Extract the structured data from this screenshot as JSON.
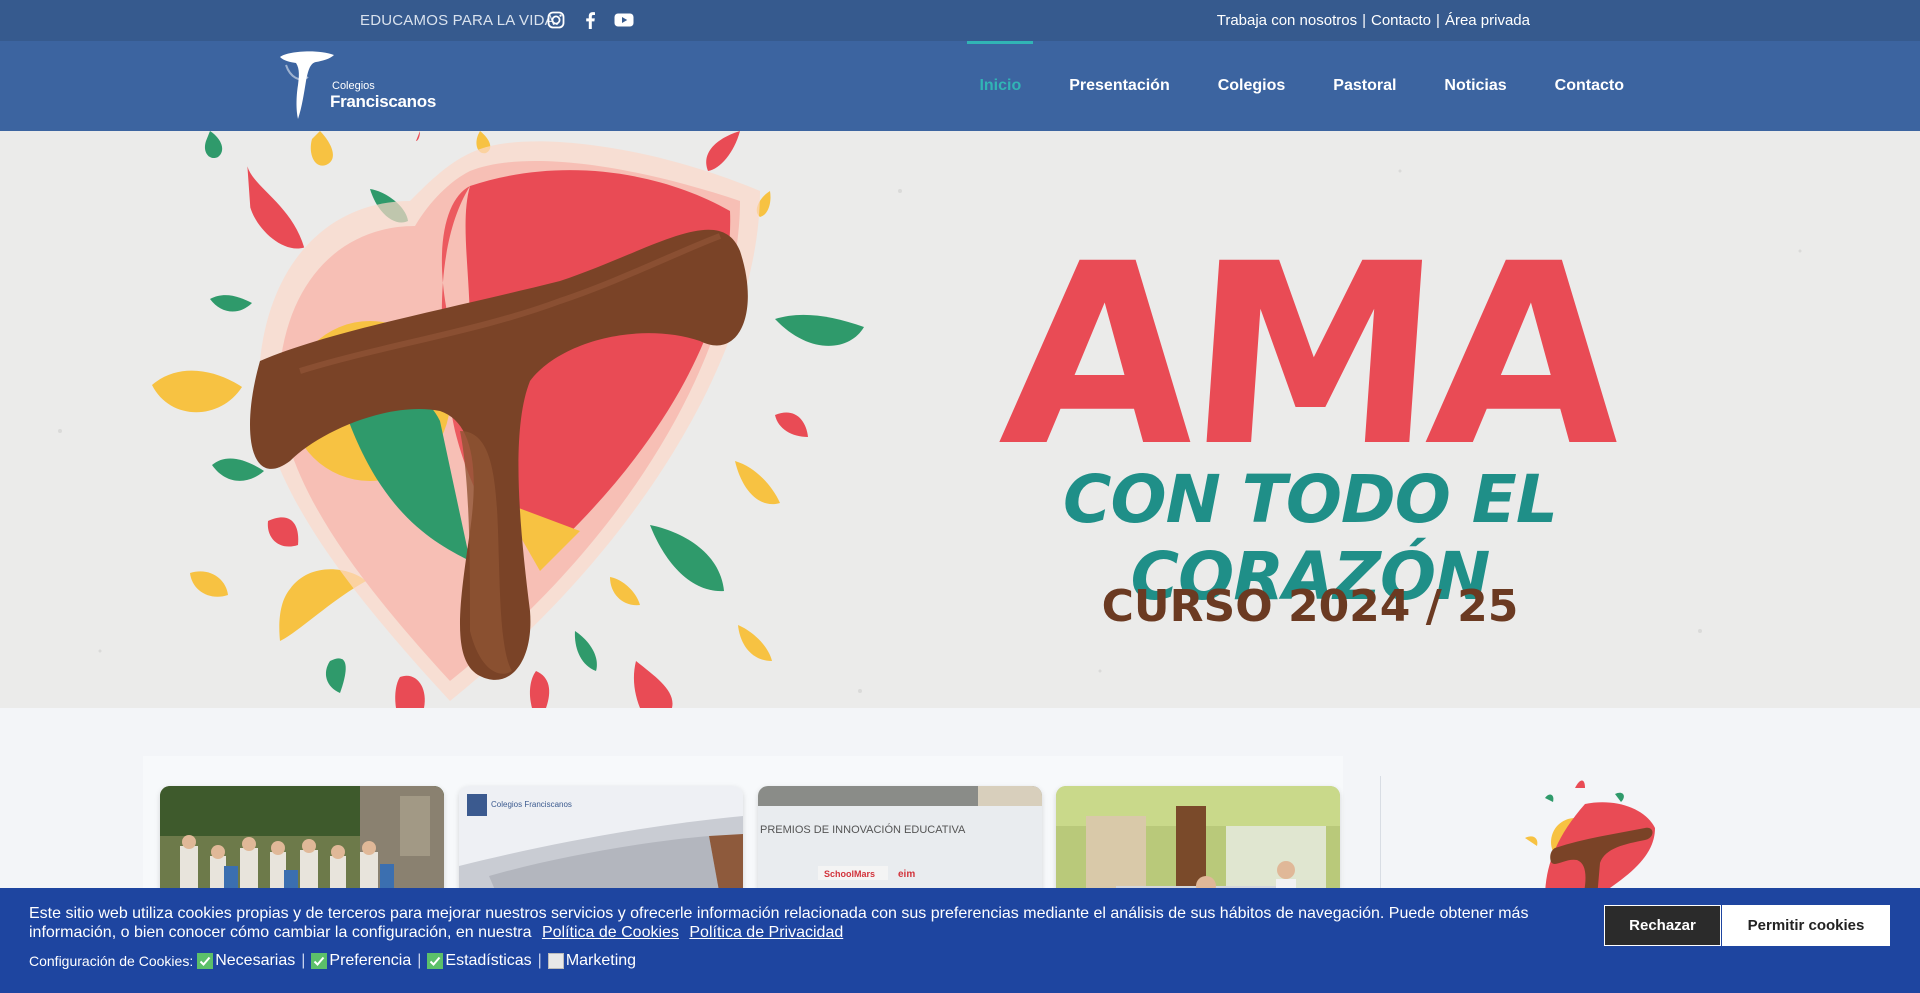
{
  "topbar": {
    "tagline": "EDUCAMOS PARA LA VIDA.",
    "socials": [
      "instagram-icon",
      "facebook-icon",
      "youtube-icon"
    ],
    "links": [
      "Trabaja con nosotros",
      "Contacto",
      "Área privada"
    ],
    "separator": "|"
  },
  "logo": {
    "line1": "Colegios",
    "line2": "Franciscanos"
  },
  "nav": {
    "items": [
      "Inicio",
      "Presentación",
      "Colegios",
      "Pastoral",
      "Noticias",
      "Contacto"
    ],
    "active": "Inicio",
    "active_color": "#31b4b5"
  },
  "hero": {
    "headline": "AMA",
    "subheadline": "CON TODO EL CORAZÓN",
    "course": "CURSO 2024 / 25",
    "colors": {
      "red": "#e94b55",
      "teal": "#1f8f88",
      "brown": "#6b3a22",
      "yellow": "#f7c242",
      "green": "#2f9a6b"
    }
  },
  "news": {
    "cards": [
      {
        "image": "group-photo"
      },
      {
        "image": "building-photo",
        "caption": "Colegios Franciscanos"
      },
      {
        "image": "award-banner-photo",
        "caption": "PREMIOS DE INNOVACIÓN EDUCATIVA"
      },
      {
        "image": "classroom-photo"
      }
    ]
  },
  "cookie": {
    "message": "Este sitio web utiliza cookies propias y de terceros para mejorar nuestros servicios y ofrecerle información relacionada con sus preferencias mediante el análisis de sus hábitos de navegación. Puede obtener más información, o bien conocer cómo cambiar la configuración, en nuestra",
    "links": [
      "Política de Cookies",
      "Política de Privacidad"
    ],
    "config_label": "Configuración de Cookies:",
    "options": [
      {
        "label": "Necesarias",
        "checked": true
      },
      {
        "label": "Preferencia",
        "checked": true
      },
      {
        "label": "Estadísticas",
        "checked": true
      },
      {
        "label": "Marketing",
        "checked": false
      }
    ],
    "reject_label": "Rechazar",
    "allow_label": "Permitir cookies"
  }
}
